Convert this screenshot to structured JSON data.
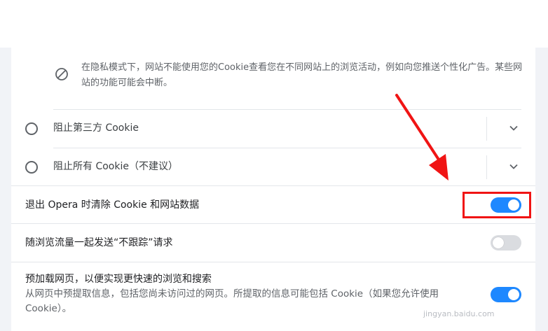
{
  "privacy_note": {
    "icon": "block-icon",
    "text": "在隐私模式下，网站不能使用您的Cookie查看您在不同网站上的浏览活动，例如向您推送个性化广告。某些网站的功能可能会中断。"
  },
  "cookie_options": [
    {
      "label": "阻止第三方 Cookie",
      "selected": false
    },
    {
      "label": "阻止所有 Cookie（不建议）",
      "selected": false
    }
  ],
  "settings": {
    "clear_on_exit": {
      "label": "退出 Opera 时清除 Cookie 和网站数据",
      "enabled": true
    },
    "do_not_track": {
      "label": "随浏览流量一起发送“不跟踪”请求",
      "enabled": false
    },
    "preload": {
      "label": "预加载网页，以便实现更快速的浏览和搜索",
      "description": "从网页中预提取信息，包括您尚未访问过的网页。所提取的信息可能包括 Cookie（如果您允许使用 Cookie）。",
      "enabled": true
    }
  },
  "colors": {
    "toggle_on": "#1e88ff",
    "toggle_off": "#dadce0",
    "annotation_red": "#f01414"
  },
  "watermark": "jingyan.baidu.com"
}
